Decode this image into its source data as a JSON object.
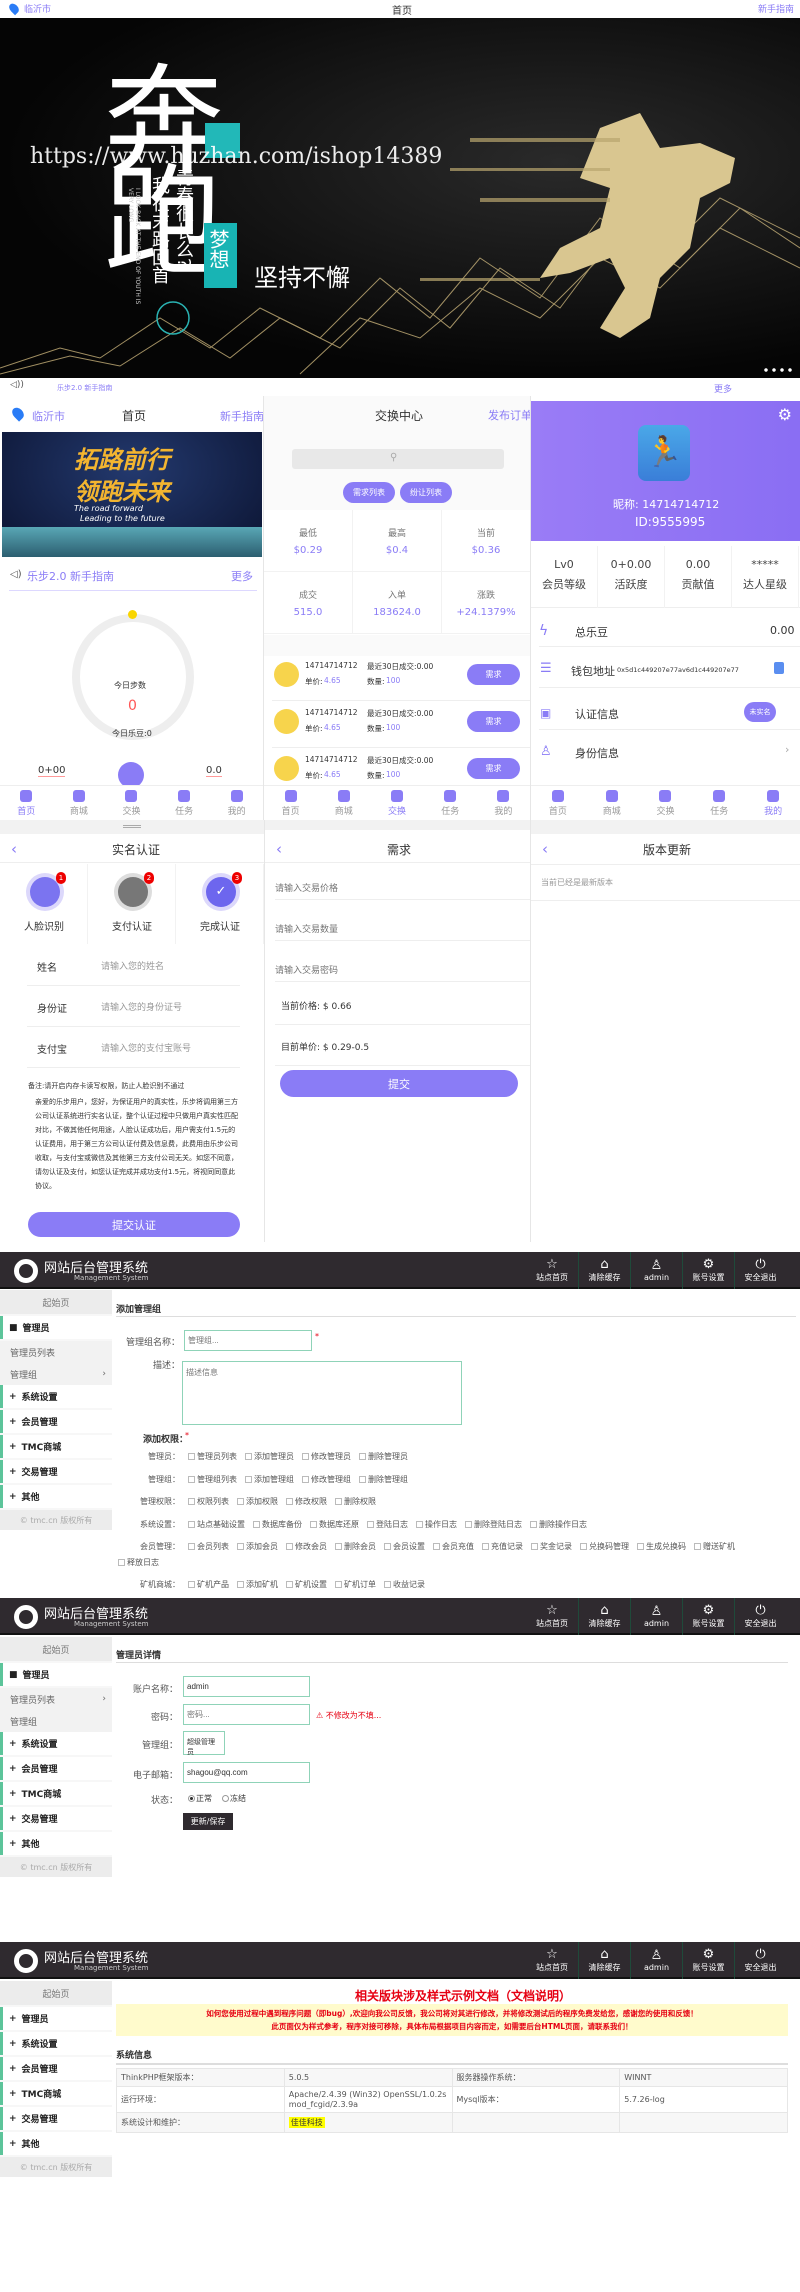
{
  "top_bar": {
    "location": "临沂市",
    "title": "首页",
    "guide": "新手指南"
  },
  "banner": {
    "big_text": "奔跑",
    "vertical_1": "青春很长么?",
    "vertical_2": "我在末路回首",
    "english": "I LOOK BACK AT THE END OF YOUTH IS VERY LONG",
    "dream": "梦想",
    "slogan": "坚持不懈",
    "url_overlay": "https://www.huzhan.com/ishop14389"
  },
  "strip": {
    "notice": "乐步2.0 新手指南",
    "more": "更多"
  },
  "home_panel": {
    "location": "临沂市",
    "title": "首页",
    "guide": "新手指南",
    "banner_title_1": "拓路前行",
    "banner_title_2": "领跑未来",
    "banner_en_1": "The road forward",
    "banner_en_2": "Leading to the future",
    "notice": "乐步2.0 新手指南",
    "more": "更多",
    "steps_label": "今日步数",
    "steps_value": "0",
    "beans_label": "今日乐豆:0",
    "left_value": "0+00",
    "right_value": "0.0"
  },
  "tabs": [
    "首页",
    "商城",
    "交换",
    "任务",
    "我的"
  ],
  "exchange_panel": {
    "title": "交换中心",
    "publish": "发布订单",
    "btn_demand": "需求列表",
    "btn_transfer": "纷让列表",
    "stats": [
      {
        "label": "最低",
        "value": "$0.29"
      },
      {
        "label": "最高",
        "value": "$0.4"
      },
      {
        "label": "当前",
        "value": "$0.36"
      },
      {
        "label": "成交",
        "value": "515.0"
      },
      {
        "label": "入单",
        "value": "183624.0"
      },
      {
        "label": "涨跌",
        "value": "+24.1379%"
      }
    ],
    "orders": [
      {
        "name": "14714714712",
        "recent": "最近30日成交:0.00",
        "price_label": "单价:",
        "price": "4.65",
        "qty_label": "数量:",
        "qty": "100",
        "action": "需求"
      },
      {
        "name": "14714714712",
        "recent": "最近30日成交:0.00",
        "price_label": "单价:",
        "price": "4.65",
        "qty_label": "数量:",
        "qty": "100",
        "action": "需求"
      },
      {
        "name": "14714714712",
        "recent": "最近30日成交:0.00",
        "price_label": "单价:",
        "price": "4.65",
        "qty_label": "数量:",
        "qty": "100",
        "action": "需求"
      }
    ]
  },
  "profile_panel": {
    "more": "更多",
    "nickname": "昵称:  14714714712",
    "id": "ID:9555995",
    "stats": [
      {
        "value": "Lv0",
        "label": "会员等级"
      },
      {
        "value": "0+0.00",
        "label": "活跃度"
      },
      {
        "value": "0.00",
        "label": "贡献值"
      },
      {
        "value": "*****",
        "label": "达人星级"
      }
    ],
    "rows": {
      "beans_label": "总乐豆",
      "beans_value": "0.00",
      "wallet_label": "钱包地址",
      "wallet_value": "0x5d1c449207e77av6d1c449207e77",
      "auth_label": "认证信息",
      "auth_badge": "未实名",
      "identity_label": "身份信息"
    }
  },
  "realname_panel": {
    "title": "实名认证",
    "steps": [
      {
        "label": "人脸识别",
        "badge": "1"
      },
      {
        "label": "支付认证",
        "badge": "2"
      },
      {
        "label": "完成认证",
        "badge": "3"
      }
    ],
    "fields": [
      {
        "label": "姓名",
        "placeholder": "请输入您的姓名"
      },
      {
        "label": "身份证",
        "placeholder": "请输入您的身份证号"
      },
      {
        "label": "支付宝",
        "placeholder": "请输入您的支付宝账号"
      }
    ],
    "note_title": "备注:请开启内存卡读写权限，防止人脸识别不通过",
    "note_body": "亲爱的乐步用户，您好，为保证用户的真实性，乐步将调用第三方公司认证系统进行实名认证，整个认证过程中只做用户真实性匹配对比，不做其他任何用途，人脸认证成功后，用户需支付1.5元的认证费用，用于第三方公司认证付费及信息费，此费用由乐步公司收取，与支付宝或微信及其他第三方支付公司无关。如您不同意，请勿认证及支付，如您认证完成并成功支付1.5元，将视同同意此协议。",
    "submit": "提交认证"
  },
  "demand_panel": {
    "title": "需求",
    "placeholders": [
      "请输入交易价格",
      "请输入交易数量",
      "请输入交易密码"
    ],
    "current_price": "当前价格: $ 0.66",
    "unit_price": "目前单价: $ 0.29-0.5",
    "submit": "提交"
  },
  "version_panel": {
    "title": "版本更新",
    "message": "当前已经是最新版本"
  },
  "admin_header": {
    "title": "网站后台管理系统",
    "subtitle": "Management System",
    "buttons": [
      "站点首页",
      "清除缓存",
      "admin",
      "账号设置",
      "安全退出"
    ]
  },
  "admin_sidebar": {
    "home": "起始页",
    "admins": "管理员",
    "admin_list": "管理员列表",
    "admin_group": "管理组",
    "system": "系统设置",
    "members": "会员管理",
    "tmc": "TMC商城",
    "trade": "交易管理",
    "other": "其他",
    "footer": "© tmc.cn 版权所有"
  },
  "add_group": {
    "heading": "添加管理组",
    "name_label": "管理组名称：",
    "name_placeholder": "管理组...",
    "desc_label": "描述：",
    "desc_placeholder": "描述信息",
    "perm_label": "添加权限：",
    "perm_rows": [
      {
        "label": "管理员：",
        "items": [
          "管理员列表",
          "添加管理员",
          "修改管理员",
          "删除管理员"
        ]
      },
      {
        "label": "管理组：",
        "items": [
          "管理组列表",
          "添加管理组",
          "修改管理组",
          "删除管理组"
        ]
      },
      {
        "label": "管理权限：",
        "items": [
          "权限列表",
          "添加权限",
          "修改权限",
          "删除权限"
        ]
      },
      {
        "label": "系统设置：",
        "items": [
          "站点基础设置",
          "数据库备份",
          "数据库还原",
          "登陆日志",
          "操作日志",
          "删除登陆日志",
          "删除操作日志"
        ]
      },
      {
        "label": "会员管理：",
        "items": [
          "会员列表",
          "添加会员",
          "修改会员",
          "删除会员",
          "会员设置",
          "会员充值",
          "充值记录",
          "奖金记录",
          "兑换码管理",
          "生成兑换码",
          "赠送矿机"
        ]
      },
      {
        "label": "",
        "items": [
          "释放日志"
        ]
      },
      {
        "label": "矿机商城：",
        "items": [
          "矿机产品",
          "添加矿机",
          "矿机设置",
          "矿机订单",
          "收益记录"
        ]
      }
    ]
  },
  "admin_detail": {
    "heading": "管理员详情",
    "account_label": "账户名称：",
    "account_value": "admin",
    "password_label": "密码：",
    "password_placeholder": "密码...",
    "password_hint": "⚠ 不修改为不填...",
    "group_label": "管理组：",
    "group_value": "超级管理员",
    "email_label": "电子邮箱：",
    "email_value": "shagou@qq.com",
    "status_label": "状态：",
    "status_normal": "正常",
    "status_frozen": "冻结",
    "save": "更新/保存"
  },
  "docs_page": {
    "title": "相关版块涉及样式示例文档（文档说明）",
    "notice_1": "如何您使用过程中遇到程序问题（即bug）,欢迎向我公司反馈，我公司将对其进行修改，并将修改测试后的程序免费发给您，感谢您的使用和反馈！",
    "notice_2": "此页面仅为样式参考，程序对接可移除，具体布局根据项目内容而定，如需要后台HTML页面，请联系我们！",
    "section": "系统信息",
    "table": [
      [
        "ThinkPHP框架版本：",
        "5.0.5",
        "服务器操作系统：",
        "WINNT"
      ],
      [
        "运行环境：",
        "Apache/2.4.39 (Win32) OpenSSL/1.0.2s mod_fcgid/2.3.9a",
        "Mysql版本：",
        "5.7.26-log"
      ],
      [
        "系统设计和维护：",
        "佳佳科技",
        "",
        ""
      ]
    ]
  },
  "colors": {
    "accent": "#8a7cf6",
    "admin_header": "#2f2a2f",
    "sidebar_accent": "#5cc49a",
    "alert": "#e60012",
    "notice_bg": "#fffbcc"
  }
}
